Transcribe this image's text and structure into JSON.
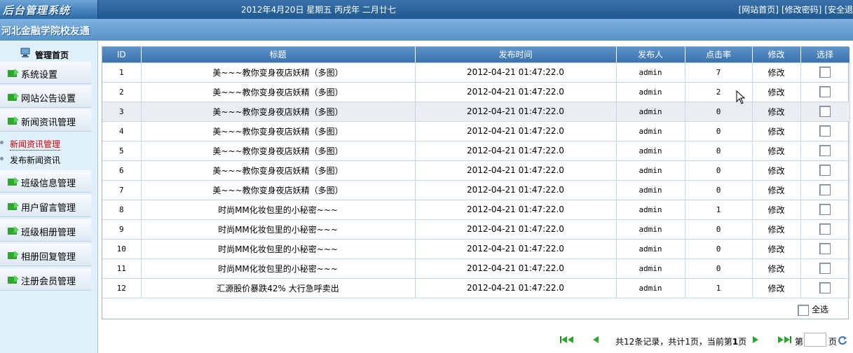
{
  "header": {
    "logo": "后台管理系统",
    "date": "2012年4月20日 星期五 丙戌年 二月廿七",
    "links": [
      "[网站首页]",
      "[修改密码]",
      "[安全退"
    ]
  },
  "subheader": {
    "site_name": "河北金融学院校友通"
  },
  "sidebar": {
    "home": "管理首页",
    "items": [
      {
        "label": "系统设置"
      },
      {
        "label": "网站公告设置"
      },
      {
        "label": "新闻资讯管理"
      },
      {
        "label": "班级信息管理"
      },
      {
        "label": "用户留言管理"
      },
      {
        "label": "班级相册管理"
      },
      {
        "label": "相册回复管理"
      },
      {
        "label": "注册会员管理"
      }
    ],
    "subitems": [
      {
        "label": "新闻资讯管理"
      },
      {
        "label": "发布新闻资讯"
      }
    ]
  },
  "table": {
    "columns": [
      "ID",
      "标题",
      "发布时间",
      "发布人",
      "点击率",
      "修改",
      "选择"
    ],
    "rows": [
      {
        "id": "1",
        "title": "美~~~教你变身夜店妖精（多图）",
        "time": "2012-04-21 01:47:22.0",
        "author": "admin",
        "clicks": "7",
        "edit": "修改"
      },
      {
        "id": "2",
        "title": "美~~~教你变身夜店妖精（多图）",
        "time": "2012-04-21 01:47:22.0",
        "author": "admin",
        "clicks": "2",
        "edit": "修改"
      },
      {
        "id": "3",
        "title": "美~~~教你变身夜店妖精（多图）",
        "time": "2012-04-21 01:47:22.0",
        "author": "admin",
        "clicks": "0",
        "edit": "修改"
      },
      {
        "id": "4",
        "title": "美~~~教你变身夜店妖精（多图）",
        "time": "2012-04-21 01:47:22.0",
        "author": "admin",
        "clicks": "0",
        "edit": "修改"
      },
      {
        "id": "5",
        "title": "美~~~教你变身夜店妖精（多图）",
        "time": "2012-04-21 01:47:22.0",
        "author": "admin",
        "clicks": "0",
        "edit": "修改"
      },
      {
        "id": "6",
        "title": "美~~~教你变身夜店妖精（多图）",
        "time": "2012-04-21 01:47:22.0",
        "author": "admin",
        "clicks": "0",
        "edit": "修改"
      },
      {
        "id": "7",
        "title": "美~~~教你变身夜店妖精（多图）",
        "time": "2012-04-21 01:47:22.0",
        "author": "admin",
        "clicks": "0",
        "edit": "修改"
      },
      {
        "id": "8",
        "title": "时尚MM化妆包里的小秘密~~~",
        "time": "2012-04-21 01:47:22.0",
        "author": "admin",
        "clicks": "1",
        "edit": "修改"
      },
      {
        "id": "9",
        "title": "时尚MM化妆包里的小秘密~~~",
        "time": "2012-04-21 01:47:22.0",
        "author": "admin",
        "clicks": "0",
        "edit": "修改"
      },
      {
        "id": "10",
        "title": "时尚MM化妆包里的小秘密~~~",
        "time": "2012-04-21 01:47:22.0",
        "author": "admin",
        "clicks": "0",
        "edit": "修改"
      },
      {
        "id": "11",
        "title": "时尚MM化妆包里的小秘密~~~",
        "time": "2012-04-21 01:47:22.0",
        "author": "admin",
        "clicks": "0",
        "edit": "修改"
      },
      {
        "id": "12",
        "title": "汇源股价暴跌42% 大行急呼卖出",
        "time": "2012-04-21 01:47:22.0",
        "author": "admin",
        "clicks": "1",
        "edit": "修改"
      }
    ],
    "select_all": "全选"
  },
  "pager": {
    "summary_prefix": "共12条记录，共计1页，当前第",
    "current_page": "1",
    "summary_suffix": "页",
    "goto_prefix": "第",
    "goto_suffix": "页"
  },
  "colors": {
    "header_blue": "#1f578f",
    "sub_blue": "#5793c8",
    "link_red": "#d20000",
    "icon_green": "#2fa52f"
  }
}
